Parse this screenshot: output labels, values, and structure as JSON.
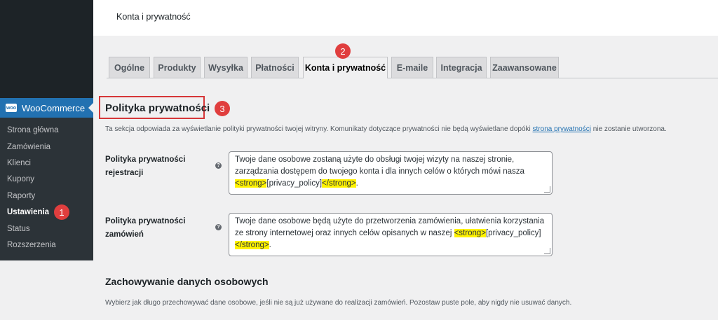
{
  "header": {
    "title": "Konta i prywatność"
  },
  "sidebar": {
    "woocommerce_label": "WooCommerce",
    "woocommerce_icon_text": "woo",
    "items": [
      {
        "label": "Strona główna"
      },
      {
        "label": "Zamówienia"
      },
      {
        "label": "Klienci"
      },
      {
        "label": "Kupony"
      },
      {
        "label": "Raporty"
      },
      {
        "label": "Ustawienia"
      },
      {
        "label": "Status"
      },
      {
        "label": "Rozszerzenia"
      }
    ],
    "current_item": "Ustawienia"
  },
  "tabs": [
    {
      "label": "Ogólne"
    },
    {
      "label": "Produkty"
    },
    {
      "label": "Wysyłka"
    },
    {
      "label": "Płatności"
    },
    {
      "label": "Konta i prywatność"
    },
    {
      "label": "E-maile"
    },
    {
      "label": "Integracja"
    },
    {
      "label": "Zaawansowane"
    }
  ],
  "active_tab": "Konta i prywatność",
  "markers": [
    "1",
    "2",
    "3"
  ],
  "privacy": {
    "title": "Polityka prywatności",
    "description_before": "Ta sekcja odpowiada za wyświetlanie polityki prywatności twojej witryny. Komunikaty dotyczące prywatności nie będą wyświetlane dopóki ",
    "description_link": "strona prywatności",
    "description_after": " nie zostanie utworzona.",
    "fields": [
      {
        "label": "Polityka prywatności rejestracji",
        "help_icon": "?",
        "value_text": "Twoje dane osobowe zostaną użyte do obsługi twojej wizyty na naszej stronie, zarządzania dostępem do twojego konta i dla innych celów o których mówi nasza ",
        "tag_open": "<strong>",
        "placeholder": "[privacy_policy]",
        "tag_close": "</strong>",
        "end": "."
      },
      {
        "label": "Polityka prywatności zamówień",
        "help_icon": "?",
        "value_text": "Twoje dane osobowe będą użyte do przetworzenia zamówienia, ułatwienia korzystania ze strony internetowej oraz innych celów opisanych w naszej ",
        "tag_open": "<strong>",
        "placeholder": "[privacy_policy]",
        "tag_close": "</strong>",
        "end": "."
      }
    ]
  },
  "retention": {
    "title": "Zachowywanie danych osobowych",
    "description": "Wybierz jak długo przechowywać dane osobowe, jeśli nie są już używane do realizacji zamówień. Pozostaw puste pole, aby nigdy nie usuwać danych."
  },
  "colors": {
    "accent": "#2271b1",
    "marker": "#e03e3e",
    "highlight": "#fff200",
    "sidebar": "#1d2327"
  }
}
